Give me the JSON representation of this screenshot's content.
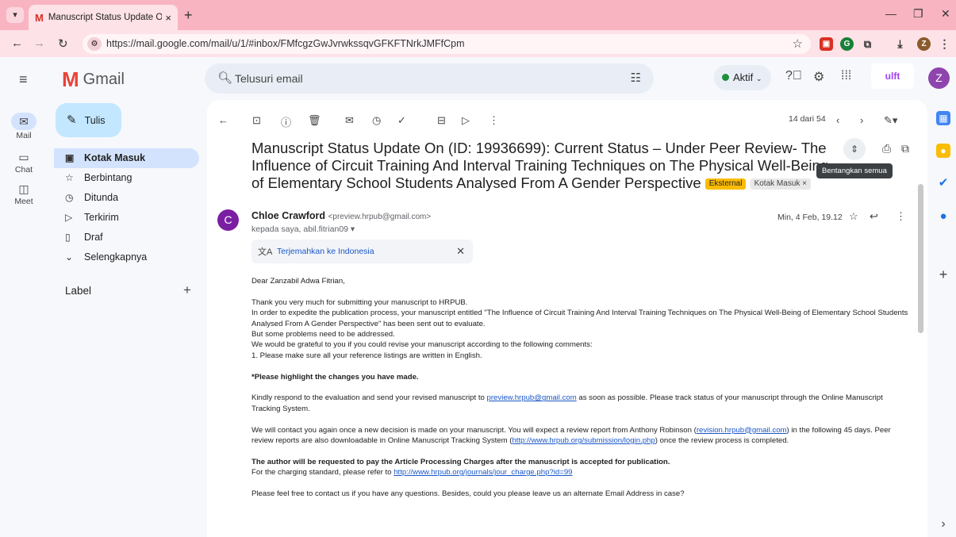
{
  "browser": {
    "tab_title": "Manuscript Status Update On (",
    "tab_close": "×",
    "new_tab": "+",
    "url": "https://mail.google.com/mail/u/1/#inbox/FMfcgzGwJvrwkssqvGFKFTNrkJMFfCpm",
    "profile_initial": "Z"
  },
  "header": {
    "app_name": "Gmail",
    "search_placeholder": "Telusuri email",
    "status_label": "Aktif",
    "avatar_initial": "Z",
    "org_logo_text": "ulft"
  },
  "rail": [
    {
      "label": "Mail"
    },
    {
      "label": "Chat"
    },
    {
      "label": "Meet"
    }
  ],
  "sidebar": {
    "compose_label": "Tulis",
    "items": [
      {
        "label": "Kotak Masuk"
      },
      {
        "label": "Berbintang"
      },
      {
        "label": "Ditunda"
      },
      {
        "label": "Terkirim"
      },
      {
        "label": "Draf"
      },
      {
        "label": "Selengkapnya"
      }
    ],
    "label_header": "Label",
    "label_add": "+"
  },
  "toolbar": {
    "page_count": "14 dari 54"
  },
  "message": {
    "subject": "Manuscript Status Update On (ID: 19936699): Current Status – Under Peer Review- The Influence of Circuit Training And Interval Training Techniques on The Physical Well-Being of Elementary School Students Analysed From A Gender Perspective",
    "badge_external": "Eksternal",
    "badge_inbox": "Kotak Masuk ×",
    "tooltip": "Bentangkan semua",
    "sender_initial": "C",
    "sender_name": "Chloe Crawford",
    "sender_email": "<preview.hrpub@gmail.com>",
    "recipients": "kepada saya, abil.fitrian09 ▾",
    "date": "Min, 4 Feb, 19.12",
    "translate_label": "Terjemahkan ke Indonesia",
    "body": {
      "greeting": "Dear Zanzabil Adwa Fitrian,",
      "p1_l1": "Thank you very much for submitting your manuscript to HRPUB.",
      "p1_l2": "In order to expedite the publication process, your manuscript entitled \"The Influence of Circuit Training And Interval Training Techniques on The Physical Well-Being of Elementary School Students Analysed From A Gender Perspective\" has been sent out to evaluate.",
      "p1_l3": "But some problems need to be addressed.",
      "p1_l4": "We would be grateful to you if you could revise your manuscript according to the following comments:",
      "p1_l5": "1. Please make sure all your reference listings are written in English.",
      "highlight": "*Please highlight the changes you have made.",
      "p3_a": "Kindly respond to the evaluation and send your revised manuscript to ",
      "p3_link": "preview.hrpub@gmail.com",
      "p3_b": " as soon as possible. Please track status of your manuscript through the Online Manuscript Tracking System.",
      "p4_a": "We will contact you again once a new decision is made on your manuscript. You will expect a review report from Anthony Robinson (",
      "p4_link1": "revision.hrpub@gmail.com",
      "p4_b": ") in the following 45 days. Peer review reports are also downloadable in Online Manuscript Tracking System (",
      "p4_link2": "http://www.hrpub.org/submission/login.php",
      "p4_c": ") once the review process is completed.",
      "apc_bold": "The author will be requested to pay the Article Processing Charges after the manuscript is accepted for publication.",
      "apc_a": "For the charging standard, please refer to ",
      "apc_link": "http://www.hrpub.org/journals/jour_charge.php?id=99",
      "closing": "Please feel free to contact us if you have any questions. Besides, could you please leave us an alternate Email Address in case?"
    }
  },
  "colors": {
    "titlebar": "#f9b4c2",
    "compose": "#c2e7ff",
    "active_nav": "#d3e3fd",
    "external_badge": "#fbbc04",
    "link": "#1a57c9"
  }
}
